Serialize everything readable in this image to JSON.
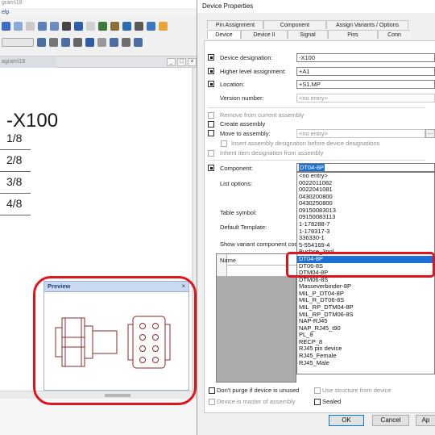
{
  "app": {
    "title_fragment": "gram\\18",
    "menu_fragment": "elp",
    "document_tab": "agram\\18",
    "window_buttons": [
      "_",
      "□",
      "×"
    ]
  },
  "sheet": {
    "title": "-X100",
    "rows": [
      "1/8",
      "2/8",
      "3/8",
      "4/8"
    ]
  },
  "preview": {
    "title": "Preview",
    "close": "×"
  },
  "dialog": {
    "title": "Device Properties",
    "tabs_row1": [
      "Pin Assignment",
      "Component",
      "Assign Variants / Options"
    ],
    "tabs_row2": [
      "Device",
      "Device II",
      "Signal",
      "Pins",
      "Conn"
    ],
    "active_tab": "Device",
    "fields": {
      "device_designation": {
        "label": "Device designation:",
        "value": "-X100",
        "checked": true
      },
      "higher_level_assignment": {
        "label": "Higher level assignment:",
        "value": "+A1",
        "checked": true
      },
      "location": {
        "label": "Location:",
        "value": "+S1.MP",
        "checked": true
      },
      "version_number": {
        "label": "Version number:",
        "placeholder": "<no entry>"
      }
    },
    "options": {
      "remove_from_assembly": "Remove from current assembly",
      "create_assembly": "Create assembly",
      "move_to_assembly": "Move to assembly:",
      "move_to_assembly_value": "<no entry>",
      "insert_designation": "Insert assembly designation before device designations",
      "inherit_designation": "Inherit item designation from assembly"
    },
    "component": {
      "label": "Component:",
      "value": "DT04-8P",
      "list_options_label": "List options:",
      "table_symbol_label": "Table symbol:",
      "default_template_label": "Default Template:",
      "show_variant_label": "Show variant component code",
      "dropdown_items": [
        "<no entry>",
        "0022011082",
        "0022041081",
        "0430200800",
        "0430250800",
        "09150083013",
        "09150083113",
        "1-178288-7",
        "1-178317-3",
        "336330-1",
        "5-554169-4",
        "Buchse_3pol",
        "DT04-8P",
        "DT06-8S",
        "DTM04-8P",
        "DTM06-8S",
        "Masseverbinder-8P",
        "MIL_P_DT04-8P",
        "MIL_R_DT06-8S",
        "MIL_RP_DTM04-8P",
        "MIL_RP_DTM06-8S",
        "NAP-RJ45",
        "NAP_RJ45_t90",
        "PL_8",
        "RECP_8",
        "RJ45 pin device",
        "RJ45_Female",
        "RJ45_Male"
      ],
      "selected_item": "DT04-8P"
    },
    "grid": {
      "column_name": "Name"
    },
    "bottom": {
      "dont_purge": "Don't purge if device is unused",
      "use_structure": "Use structure from device",
      "device_is_master": "Device is master of assembly",
      "sealed": "Sealed"
    },
    "buttons": {
      "ok": "OK",
      "cancel": "Cancel",
      "apply": "Ap"
    }
  },
  "colors": {
    "selection": "#1c6fd6",
    "annotation": "#e0141c",
    "preview_header": "#c9daf0",
    "dialog_bg": "#f0f0f0"
  }
}
